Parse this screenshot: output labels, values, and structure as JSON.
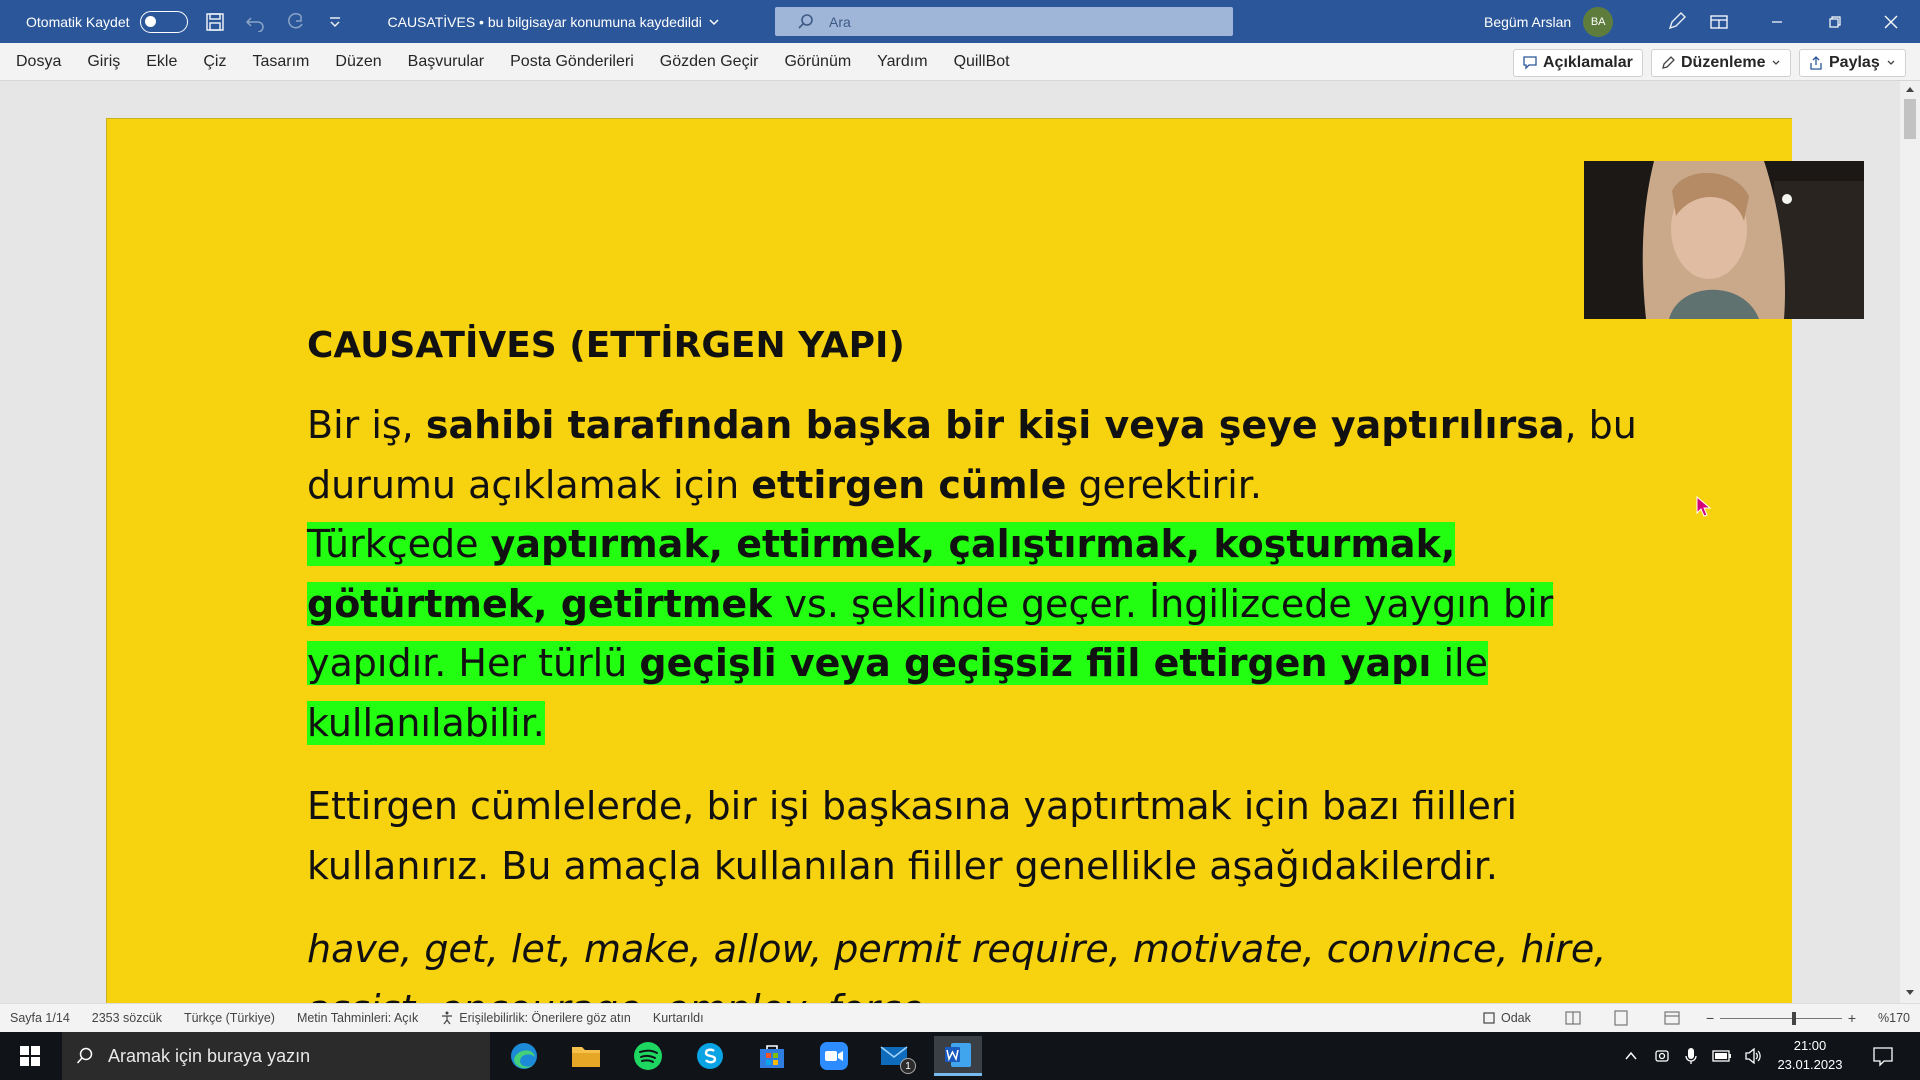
{
  "titlebar": {
    "autosave_label": "Otomatik Kaydet",
    "doc_title": "CAUSATİVES • bu bilgisayar konumuna kaydedildi",
    "search_placeholder": "Ara",
    "user_name": "Begüm Arslan",
    "user_initials": "BA"
  },
  "ribbon": {
    "tabs": [
      "Dosya",
      "Giriş",
      "Ekle",
      "Çiz",
      "Tasarım",
      "Düzen",
      "Başvurular",
      "Posta Gönderileri",
      "Gözden Geçir",
      "Görünüm",
      "Yardım",
      "QuillBot"
    ],
    "comments_label": "Açıklamalar",
    "editing_label": "Düzenleme",
    "share_label": "Paylaş"
  },
  "document": {
    "heading": "CAUSATİVES (ETTİRGEN YAPI)",
    "p1": {
      "a": "Bir iş, ",
      "b": "sahibi tarafından başka bir kişi veya şeye yaptırılırsa",
      "c": ", bu durumu açıklamak için ",
      "d": "ettirgen cümle",
      "e": " gerektirir."
    },
    "p1h": {
      "a": "Türkçede ",
      "b": "yaptırmak, ettirmek, çalıştırmak, koşturmak, götürtmek, getirtmek",
      "c": " vs. şeklinde geçer. İngilizcede yaygın bir yapıdır. Her türlü ",
      "d": "geçişli veya geçişsiz fiil ettirgen yapı",
      "e": " ile kullanılabilir."
    },
    "p2": "Ettirgen cümlelerde, bir işi başkasına yaptırtmak için bazı fiilleri kullanırız. Bu amaçla kullanılan fiiller genellikle aşağıdakilerdir.",
    "p3": "have, get, let, make, allow, permit require, motivate, convince, hire, assist, encourage, employ, force,"
  },
  "statusbar": {
    "page": "Sayfa 1/14",
    "words": "2353 sözcük",
    "language": "Türkçe (Türkiye)",
    "predictions": "Metin Tahminleri: Açık",
    "accessibility": "Erişilebilirlik: Önerilere göz atın",
    "recovered": "Kurtarıldı",
    "focus": "Odak",
    "zoom": "%170"
  },
  "taskbar": {
    "search_placeholder": "Aramak için buraya yazın",
    "time": "21:00",
    "date": "23.01.2023",
    "mail_badge": "1"
  },
  "colors": {
    "title_bar": "#2b579a",
    "page_background": "#f7d30f",
    "highlight": "#22ff11"
  }
}
